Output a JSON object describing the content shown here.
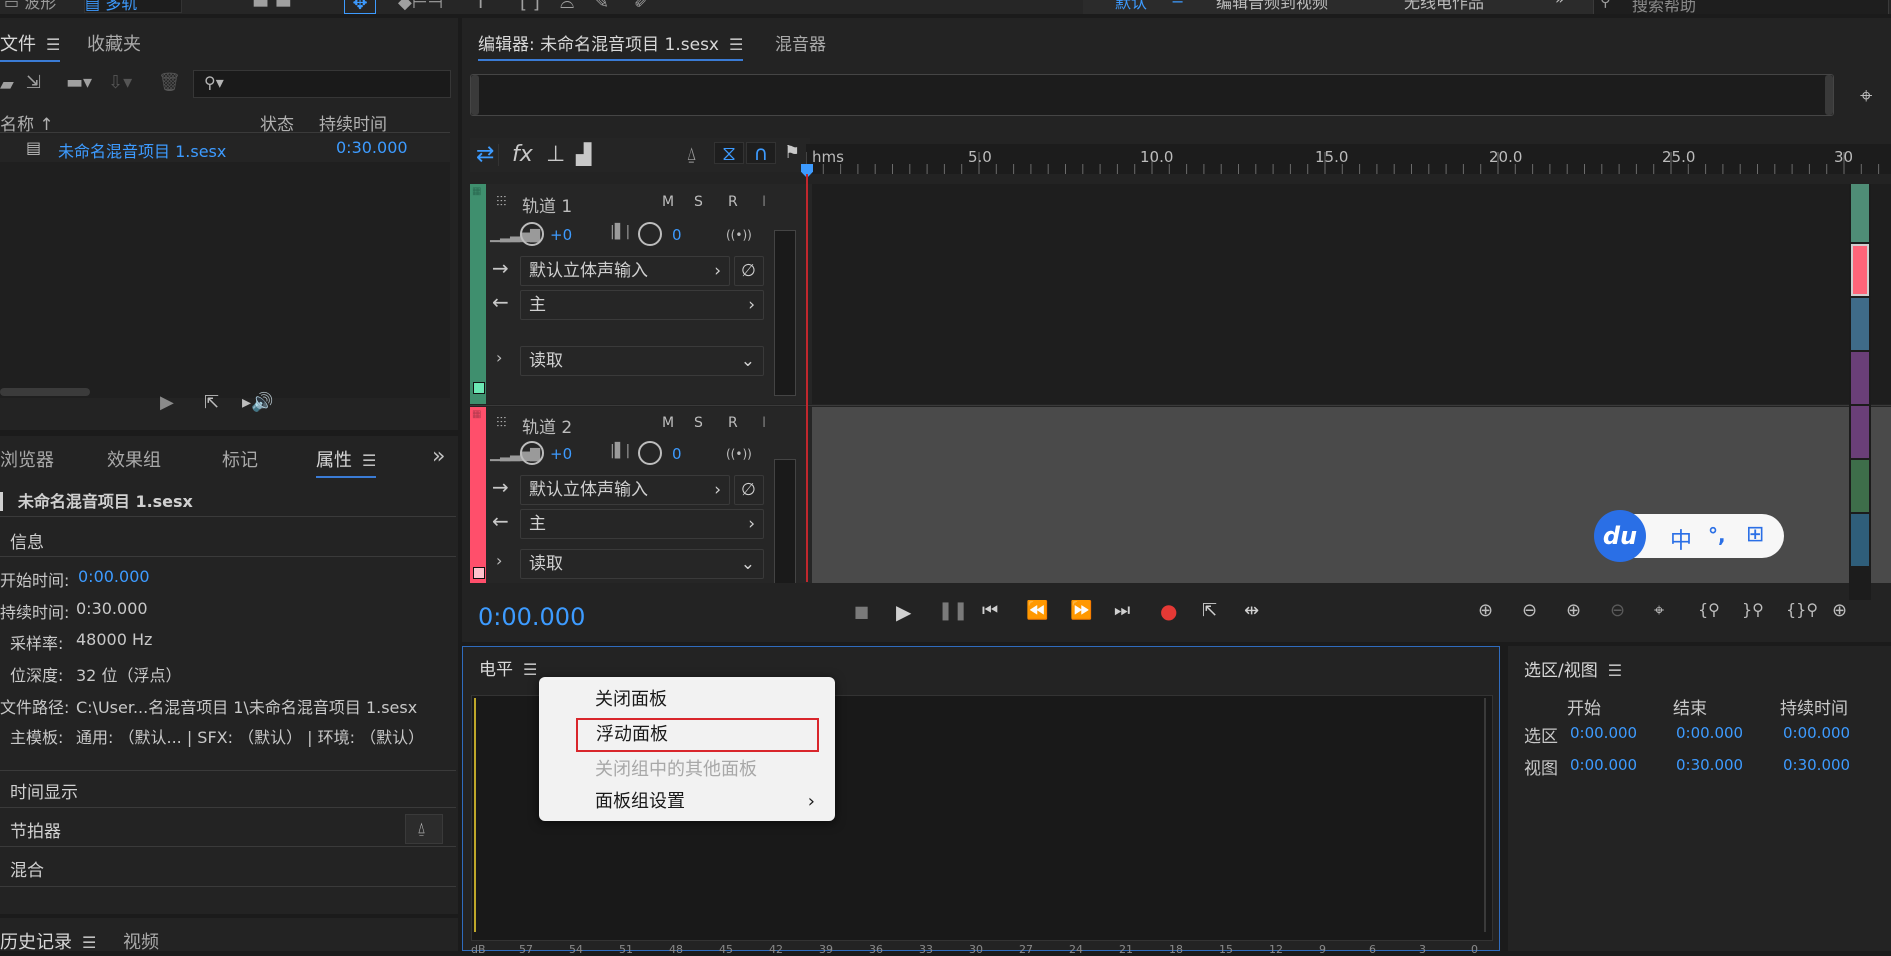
{
  "topbar": {
    "mode_waveform": "波形",
    "mode_multitrack": "多轨",
    "workspace_default": "默认",
    "workspace_edit_audio_video": "编辑音频到视频",
    "workspace_radio": "无线电作品",
    "search_placeholder": "搜索帮助"
  },
  "files_panel": {
    "tab_files": "文件",
    "tab_favorites": "收藏夹",
    "col_name": "名称",
    "col_status": "状态",
    "col_duration": "持续时间",
    "item_name": "未命名混音项目 1.sesx",
    "item_duration": "0:30.000"
  },
  "props_panel": {
    "tab_browser": "浏览器",
    "tab_effects": "效果组",
    "tab_markers": "标记",
    "tab_properties": "属性",
    "title": "未命名混音项目 1.sesx",
    "section_info": "信息",
    "start_label": "开始时间:",
    "start_value": "0:00.000",
    "duration_label": "持续时间:",
    "duration_value": "0:30.000",
    "samplerate_label": "采样率:",
    "samplerate_value": "48000 Hz",
    "bitdepth_label": "位深度:",
    "bitdepth_value": "32 位（浮点）",
    "path_label": "文件路径:",
    "path_value": "C:\\User...名混音项目 1\\未命名混音项目 1.sesx",
    "template_label": "主模板:",
    "template_value": "通用: （默认... | SFX: （默认） | 环境: （默认）",
    "section_time": "时间显示",
    "section_metronome": "节拍器",
    "section_mix": "混合"
  },
  "history_panel": {
    "tab_history": "历史记录",
    "tab_video": "视频"
  },
  "editor": {
    "tab_editor": "编辑器: 未命名混音项目 1.sesx",
    "tab_mixer": "混音器",
    "ruler_unit": "hms",
    "ruler_labels": [
      "5.0",
      "10.0",
      "15.0",
      "20.0",
      "25.0",
      "30"
    ],
    "current_time": "0:00.000",
    "track_colors": [
      "#3f8f6e",
      "#ff4f6b"
    ],
    "tracks": [
      {
        "name": "轨道 1",
        "m": "M",
        "s": "S",
        "r": "R",
        "i": "I",
        "volume": "+0",
        "pan": "0",
        "input": "默认立体声输入",
        "output": "主",
        "automation": "读取"
      },
      {
        "name": "轨道 2",
        "m": "M",
        "s": "S",
        "r": "R",
        "i": "I",
        "volume": "+0",
        "pan": "0",
        "input": "默认立体声输入",
        "output": "主",
        "automation": "读取"
      }
    ]
  },
  "levels_panel": {
    "title": "电平",
    "scale": [
      "dB",
      "57",
      "54",
      "51",
      "48",
      "45",
      "42",
      "39",
      "36",
      "33",
      "30",
      "27",
      "24",
      "21",
      "18",
      "15",
      "12",
      "9",
      "6",
      "3",
      "0"
    ]
  },
  "context_menu": {
    "item_close_panel": "关闭面板",
    "item_float_panel": "浮动面板",
    "item_close_others": "关闭组中的其他面板",
    "item_group_settings": "面板组设置"
  },
  "selection_panel": {
    "title": "选区/视图",
    "col_start": "开始",
    "col_end": "结束",
    "col_duration": "持续时间",
    "row_selection": "选区",
    "row_view": "视图",
    "sel_start": "0:00.000",
    "sel_end": "0:00.000",
    "sel_duration": "0:00.000",
    "view_start": "0:00.000",
    "view_end": "0:30.000",
    "view_duration": "0:30.000"
  },
  "ime_toolbar": {
    "logo": "du",
    "lang": "中",
    "punct": "°,"
  }
}
